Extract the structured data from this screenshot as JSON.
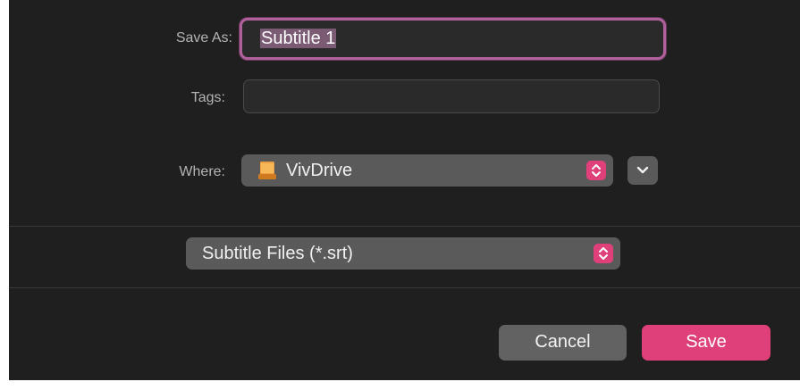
{
  "save_as": {
    "label": "Save As:",
    "value": "Subtitle 1"
  },
  "tags": {
    "label": "Tags:",
    "value": ""
  },
  "where": {
    "label": "Where:",
    "selected": "VivDrive",
    "icon": "external-drive-icon"
  },
  "format": {
    "selected": "Subtitle Files (*.srt)"
  },
  "buttons": {
    "cancel": "Cancel",
    "save": "Save"
  },
  "colors": {
    "accent": "#e0407a",
    "focus_ring": "#b0609a",
    "background": "#1f1f1f"
  }
}
